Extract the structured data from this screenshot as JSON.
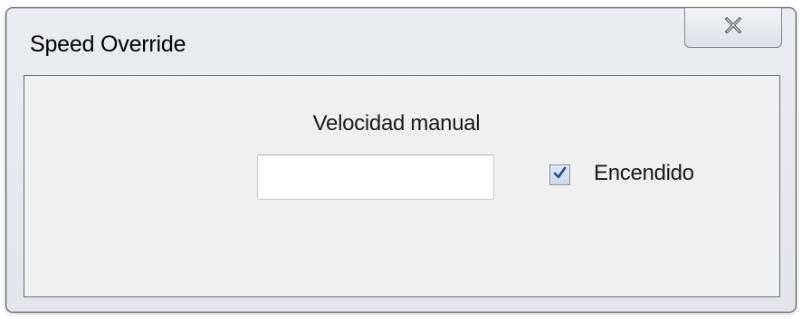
{
  "window": {
    "title": "Speed Override",
    "close_icon": "close-icon"
  },
  "form": {
    "speed_label": "Velocidad manual",
    "speed_value": "",
    "checkbox_label": "Encendido",
    "checkbox_checked": true,
    "checkbox_icon": "checkmark-icon"
  },
  "colors": {
    "window_frame": "#e6e9ed",
    "client_background": "#f0f0f0",
    "checkmark": "#2a4a8a"
  }
}
